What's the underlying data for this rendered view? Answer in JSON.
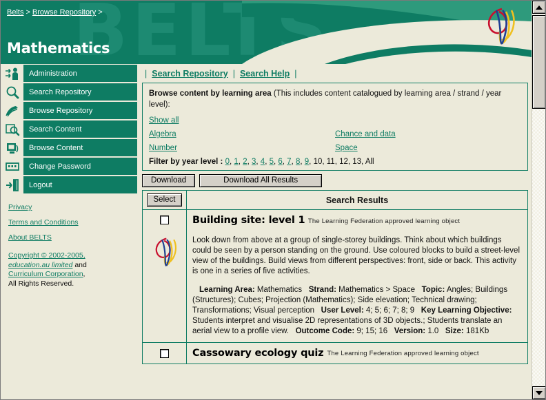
{
  "breadcrumb": {
    "items": [
      {
        "label": "Belts"
      },
      {
        "label": "Browse Repository"
      }
    ],
    "separator": ">",
    "trailing": ">"
  },
  "header": {
    "title": "Mathematics",
    "ghost_text": "BELTS",
    "logo_name": "belts-logo",
    "bg_color": "#0E7C63",
    "swoosh_color": "#ECEADA"
  },
  "sidebar": {
    "items": [
      {
        "label": "Administration",
        "icon": "admin-user-icon"
      },
      {
        "label": "Search Repository",
        "icon": "magnifier-icon"
      },
      {
        "label": "Browse Repository",
        "icon": "pages-stack-icon"
      },
      {
        "label": "Search Content",
        "icon": "page-search-icon"
      },
      {
        "label": "Browse Content",
        "icon": "monitor-icon"
      },
      {
        "label": "Change Password",
        "icon": "keypad-icon"
      },
      {
        "label": "Logout",
        "icon": "exit-door-icon"
      }
    ],
    "links": [
      {
        "label": "Privacy"
      },
      {
        "label": "Terms and Conditions"
      },
      {
        "label": "About BELTS"
      }
    ],
    "copyright": {
      "line1": "Copyright © 2002-2005,",
      "line2": "education.au limited",
      "line2b": " and",
      "line3": "Curriculum Corporation",
      "line3b": ",",
      "line4": "All Rights Reserved."
    }
  },
  "tabs": [
    {
      "label": "Search Repository"
    },
    {
      "label": "Search Help"
    }
  ],
  "browse_panel": {
    "heading": "Browse content by learning area",
    "heading_note": " (This includes content catalogued by learning area / strand / year level):",
    "show_all": "Show all",
    "areas_left": [
      "Algebra",
      "Number"
    ],
    "areas_right": [
      "Chance and data",
      "Space"
    ],
    "year_filter_label": "Filter by year level : ",
    "year_levels_linked": [
      "0",
      "1",
      "2",
      "3",
      "4",
      "5",
      "6",
      "7",
      "8",
      "9"
    ],
    "year_levels_plain": [
      "10",
      "11",
      "12",
      "13",
      "All"
    ]
  },
  "buttons": {
    "download": "Download",
    "download_all": "Download All Results",
    "select": "Select"
  },
  "results": {
    "header": "Search Results",
    "rows": [
      {
        "title": "Building site: level 1",
        "subtitle": "The Learning Federation approved learning object",
        "description": "Look down from above at a group of single-storey buildings. Think about which buildings could be seen by a person standing on the ground. Use coloured blocks to build a street-level view of the buildings. Build views from different perspectives: front, side or back. This activity is one in a series of five activities.",
        "meta": [
          {
            "key": "Learning Area:",
            "value": " Mathematics"
          },
          {
            "key": "Strand:",
            "value": " Mathematics > Space"
          },
          {
            "key": "Topic:",
            "value": " Angles; Buildings (Structures); Cubes; Projection (Mathematics); Side elevation; Technical drawing; Transformations; Visual perception"
          },
          {
            "key": "User Level:",
            "value": " 4; 5; 6; 7; 8; 9"
          },
          {
            "key": "Key Learning Objective:",
            "value": " Students interpret and visualise 2D representations of 3D objects.; Students translate an aerial view to a profile view."
          },
          {
            "key": "Outcome Code:",
            "value": " 9; 15; 16"
          },
          {
            "key": "Version:",
            "value": " 1.0"
          },
          {
            "key": "Size:",
            "value": " 181Kb"
          }
        ],
        "checked": false,
        "logo_name": "belts-logo"
      },
      {
        "title": "Cassowary ecology quiz",
        "subtitle": "The Learning Federation approved learning object",
        "checked": false
      }
    ]
  },
  "scrollbar": {
    "up_arrow": "▲",
    "down_arrow": "▼"
  },
  "colors": {
    "teal": "#0E7C63",
    "cream": "#ECEADA",
    "button_face": "#D4D0C8",
    "logo_red": "#C8102E",
    "logo_blue": "#1F3F93",
    "logo_yellow": "#EFC020"
  }
}
